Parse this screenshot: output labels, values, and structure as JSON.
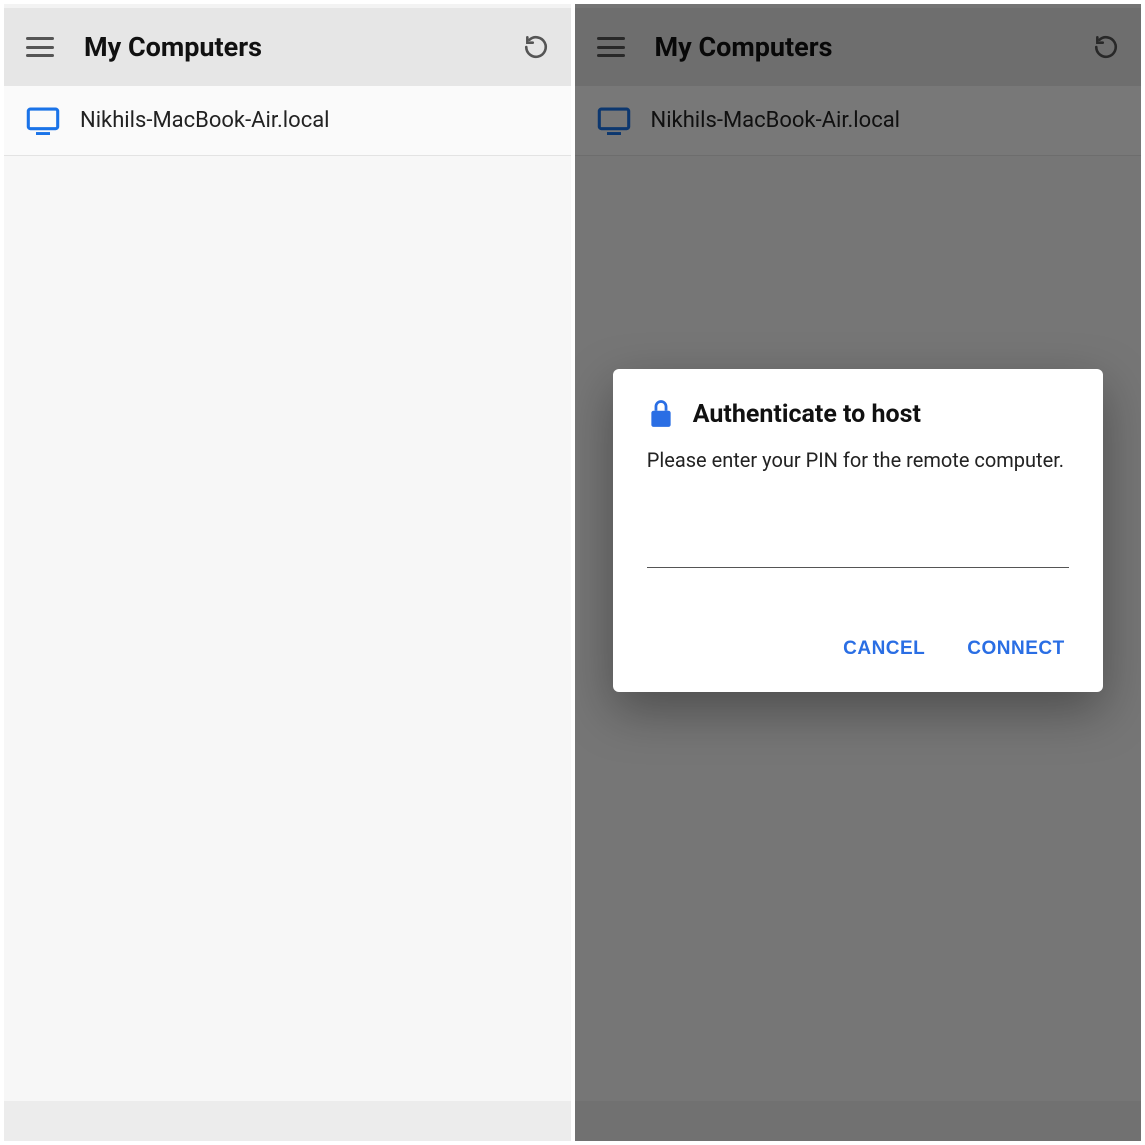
{
  "colors": {
    "accent": "#2a6ee4",
    "icon_blue": "#1a73e8"
  },
  "left": {
    "header": {
      "title": "My Computers"
    },
    "list_item": {
      "label": "Nikhils-MacBook-Air.local"
    }
  },
  "right": {
    "header": {
      "title": "My Computers"
    },
    "list_item": {
      "label": "Nikhils-MacBook-Air.local"
    },
    "dialog": {
      "title": "Authenticate to host",
      "message": "Please enter your PIN for the remote computer.",
      "pin_value": "",
      "cancel_label": "CANCEL",
      "connect_label": "CONNECT"
    }
  }
}
